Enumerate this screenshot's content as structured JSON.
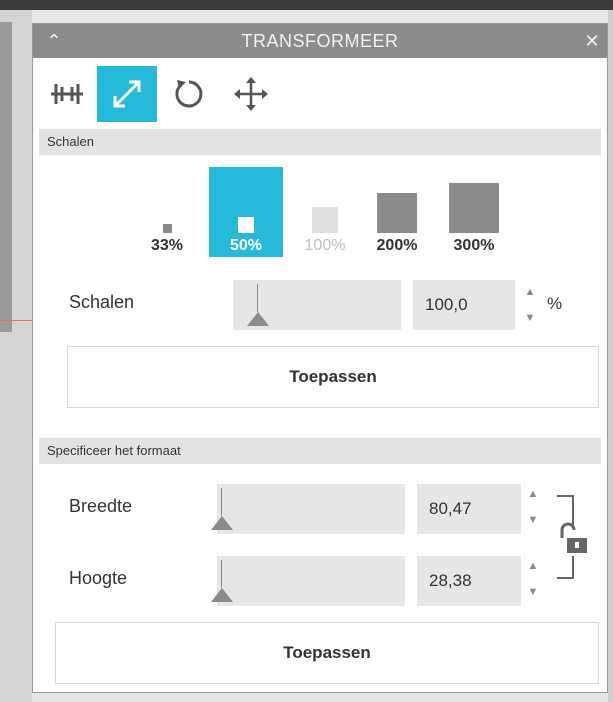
{
  "window": {
    "title": "TRANSFORMEER",
    "collapse_icon": "chevron-up-icon",
    "close_icon": "close-icon",
    "collapse_glyph": "⌃",
    "close_glyph": "✕"
  },
  "tabs": [
    {
      "name": "align",
      "icon": "align-icon",
      "active": false
    },
    {
      "name": "scale",
      "icon": "resize-arrow-icon",
      "active": true
    },
    {
      "name": "rotate",
      "icon": "rotate-icon",
      "active": false
    },
    {
      "name": "move",
      "icon": "move-icon",
      "active": false
    }
  ],
  "colors": {
    "accent": "#26b9da",
    "titlebar": "#8c8c8c",
    "section_header": "#e3e3e3",
    "field_bg": "#e6e6e6"
  },
  "scale_section": {
    "header": "Schalen",
    "presets": [
      {
        "label": "33%",
        "state": "normal"
      },
      {
        "label": "50%",
        "state": "active"
      },
      {
        "label": "100%",
        "state": "disabled"
      },
      {
        "label": "200%",
        "state": "normal"
      },
      {
        "label": "300%",
        "state": "normal"
      }
    ],
    "row_label": "Schalen",
    "value": "100,0",
    "unit": "%",
    "apply_label": "Toepassen"
  },
  "size_section": {
    "header": "Specificeer het formaat",
    "width_label": "Breedte",
    "width_value": "80,47",
    "height_label": "Hoogte",
    "height_value": "28,38",
    "lock_icon": "padlock-open-icon",
    "apply_label": "Toepassen"
  }
}
